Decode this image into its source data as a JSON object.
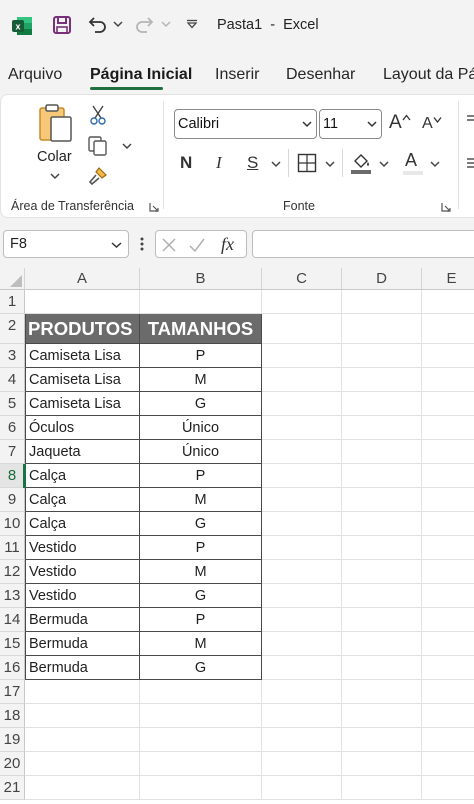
{
  "titlebar": {
    "title": "Pasta1  -  Excel"
  },
  "tabs": [
    {
      "label": "Arquivo"
    },
    {
      "label": "Página Inicial"
    },
    {
      "label": "Inserir"
    },
    {
      "label": "Desenhar"
    },
    {
      "label": "Layout da Pá"
    }
  ],
  "ribbon": {
    "clipboard": {
      "paste_label": "Colar",
      "group_label": "Área de Transferência"
    },
    "font": {
      "font_name": "Calibri",
      "font_size": "11",
      "bold": "N",
      "italic": "I",
      "underline": "S",
      "grow": "A",
      "shrink": "A",
      "color_letter": "A",
      "group_label": "Fonte"
    }
  },
  "formula_bar": {
    "name_box": "F8",
    "fx_label": "fx",
    "formula": ""
  },
  "columns": [
    "A",
    "B",
    "C",
    "D",
    "E"
  ],
  "rows": [
    "1",
    "2",
    "3",
    "4",
    "5",
    "6",
    "7",
    "8",
    "9",
    "10",
    "11",
    "12",
    "13",
    "14",
    "15",
    "16",
    "17",
    "18",
    "19",
    "20",
    "21"
  ],
  "selected": {
    "cell": "F8",
    "row": "8"
  },
  "table": {
    "headers": [
      "PRODUTOS",
      "TAMANHOS"
    ],
    "rows": [
      [
        "Camiseta Lisa",
        "P"
      ],
      [
        "Camiseta Lisa",
        "M"
      ],
      [
        "Camiseta Lisa",
        "G"
      ],
      [
        "Óculos",
        "Único"
      ],
      [
        "Jaqueta",
        "Único"
      ],
      [
        "Calça",
        "P"
      ],
      [
        "Calça",
        "M"
      ],
      [
        "Calça",
        "G"
      ],
      [
        "Vestido",
        "P"
      ],
      [
        "Vestido",
        "M"
      ],
      [
        "Vestido",
        "G"
      ],
      [
        "Bermuda",
        "P"
      ],
      [
        "Bermuda",
        "M"
      ],
      [
        "Bermuda",
        "G"
      ]
    ]
  },
  "colors": {
    "accent": "#1f6f3f",
    "header_fill": "#6b6b6b",
    "excel_green": "#107c41"
  }
}
